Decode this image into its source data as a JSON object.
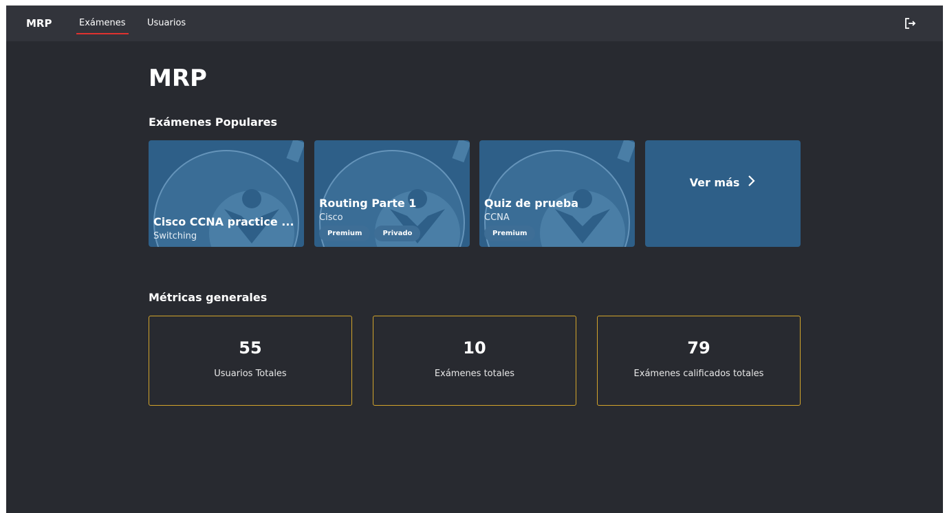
{
  "nav": {
    "brand": "MRP",
    "items": [
      {
        "label": "Exámenes",
        "active": true
      },
      {
        "label": "Usuarios",
        "active": false
      }
    ],
    "logout_icon": "logout-icon"
  },
  "main": {
    "title": "MRP",
    "popular_title": "Exámenes Populares",
    "exams": [
      {
        "title": "Cisco CCNA practice ...",
        "subtitle": "Switching",
        "badges": []
      },
      {
        "title": "Routing Parte 1",
        "subtitle": "Cisco",
        "badges": [
          "Premium",
          "Privado"
        ]
      },
      {
        "title": "Quiz de prueba",
        "subtitle": "CCNA",
        "badges": [
          "Premium"
        ]
      }
    ],
    "more_label": "Ver más",
    "more_icon": "chevron-right-icon",
    "metrics_title": "Métricas generales",
    "metrics": [
      {
        "value": "55",
        "label": "Usuarios Totales"
      },
      {
        "value": "10",
        "label": "Exámenes totales"
      },
      {
        "value": "79",
        "label": "Exámenes calificados totales"
      }
    ]
  },
  "colors": {
    "background": "#282a30",
    "topbar": "#32343b",
    "card": "#2e5f88",
    "accent_underline": "#e0322f",
    "metric_border": "#d4a52b"
  }
}
